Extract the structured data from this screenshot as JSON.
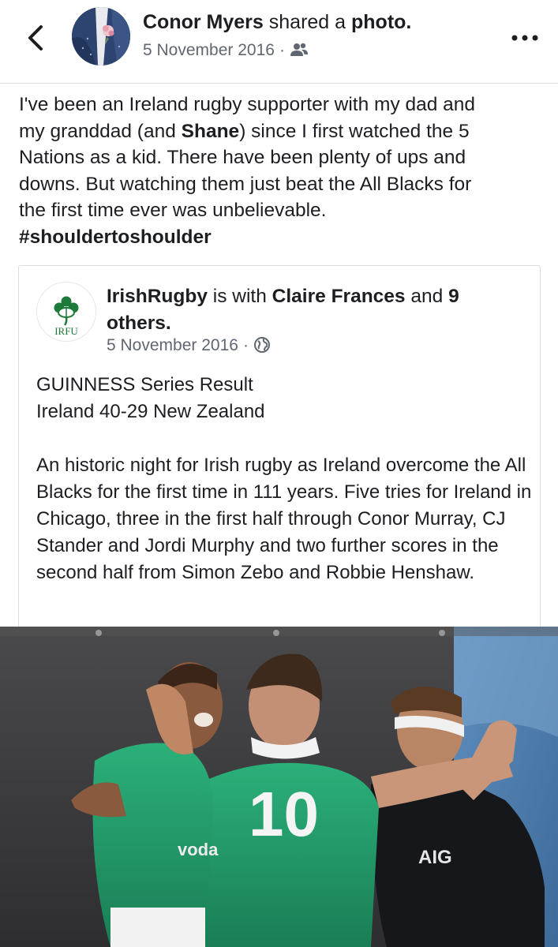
{
  "header": {
    "author": "Conor Myers",
    "action_prefix": "shared a",
    "action_object": "photo.",
    "date": "5 November 2016",
    "dot": "·",
    "privacy_icon": "friends-icon",
    "back_icon": "chevron-left-icon",
    "more_icon": "more-dots-icon"
  },
  "post": {
    "line1": "I've been an Ireland rugby supporter with my dad and",
    "line2_before": "my granddad (and ",
    "line2_bold": "Shane",
    "line2_after": ") since I first watched the 5",
    "line3": "Nations as a kid.  There have been plenty of ups and",
    "line4": "downs.  But watching them just beat the All Blacks for",
    "line5": "the first time ever was unbelievable.",
    "hashtag": "#shouldertoshoulder"
  },
  "shared": {
    "page_name": "IrishRugby",
    "is_with": "is with",
    "tagged": "Claire Frances",
    "and": "and",
    "others": "9 others.",
    "date": "5 November 2016",
    "dot": "·",
    "privacy_icon": "globe-icon",
    "logo_text": "IRFU",
    "result_line1": "GUINNESS Series Result",
    "result_line2": "Ireland 40-29 New Zealand",
    "body": "An historic night for Irish rugby as Ireland overcome the All Blacks for the first time in 111 years. Five tries for Ireland in Chicago, three in the first half through Conor Murray, CJ Stander and Jordi Murphy and two further scores in the second half from Simon Zebo and Robbie Henshaw."
  },
  "photo": {
    "jersey_number": "10",
    "sponsor_irish": "voda",
    "sponsor_nz": "AIG",
    "colors": {
      "ireland_green": "#1f9a6a",
      "nz_black": "#15171a",
      "backdrop": "#3a3a3c",
      "sky_blue": "#4d7fb0"
    }
  },
  "colors": {
    "text": "#1c1e21",
    "meta": "#606770",
    "border": "#dadde1",
    "irfu_green": "#1d7a3a"
  }
}
